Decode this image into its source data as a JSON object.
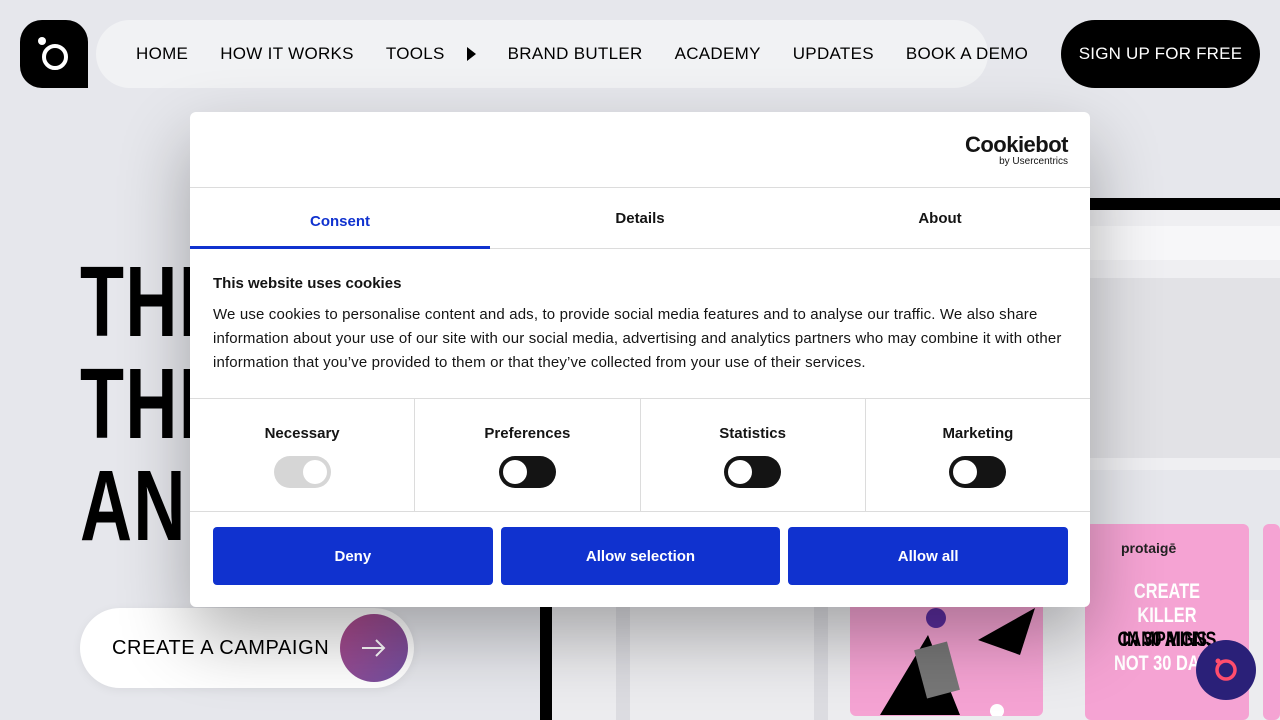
{
  "nav": {
    "items": [
      {
        "label": "HOME"
      },
      {
        "label": "HOW IT WORKS"
      },
      {
        "label": "TOOLS"
      },
      {
        "label": "BRAND BUTLER"
      },
      {
        "label": "ACADEMY"
      },
      {
        "label": "UPDATES"
      },
      {
        "label": "BOOK A DEMO"
      }
    ],
    "signup_label": "SIGN UP FOR FREE"
  },
  "hero": {
    "lines": [
      "THE",
      "THI",
      "AN"
    ],
    "cta_label": "CREATE A CAMPAIGN"
  },
  "promo_card": {
    "logo_text": "protaigē",
    "line1": "CREATE",
    "line2_accent": "KILLER",
    "line2_rest": "CAMPAIGNS",
    "line3": "IN 30 MINS,",
    "line4": "NOT 30 DAYS"
  },
  "cookie_dialog": {
    "brand_main": "Cookiebot",
    "brand_sub": "by Usercentrics",
    "tabs": [
      {
        "label": "Consent",
        "active": true
      },
      {
        "label": "Details",
        "active": false
      },
      {
        "label": "About",
        "active": false
      }
    ],
    "title": "This website uses cookies",
    "text": "We use cookies to personalise content and ads, to provide social media features and to analyse our traffic. We also share information about your use of our site with our social media, advertising and analytics partners who may combine it with other information that you’ve provided to them or that they’ve collected from your use of their services.",
    "toggles": [
      {
        "label": "Necessary",
        "state": "on-disabled"
      },
      {
        "label": "Preferences",
        "state": "off"
      },
      {
        "label": "Statistics",
        "state": "off"
      },
      {
        "label": "Marketing",
        "state": "off"
      }
    ],
    "buttons": {
      "deny": "Deny",
      "allow_selection": "Allow selection",
      "allow_all": "Allow all"
    }
  },
  "colors": {
    "accent": "#1032cf",
    "page_bg": "#e6e7ec",
    "card_pink": "#f5a3d3",
    "chat_bubble": "#2a2078"
  }
}
